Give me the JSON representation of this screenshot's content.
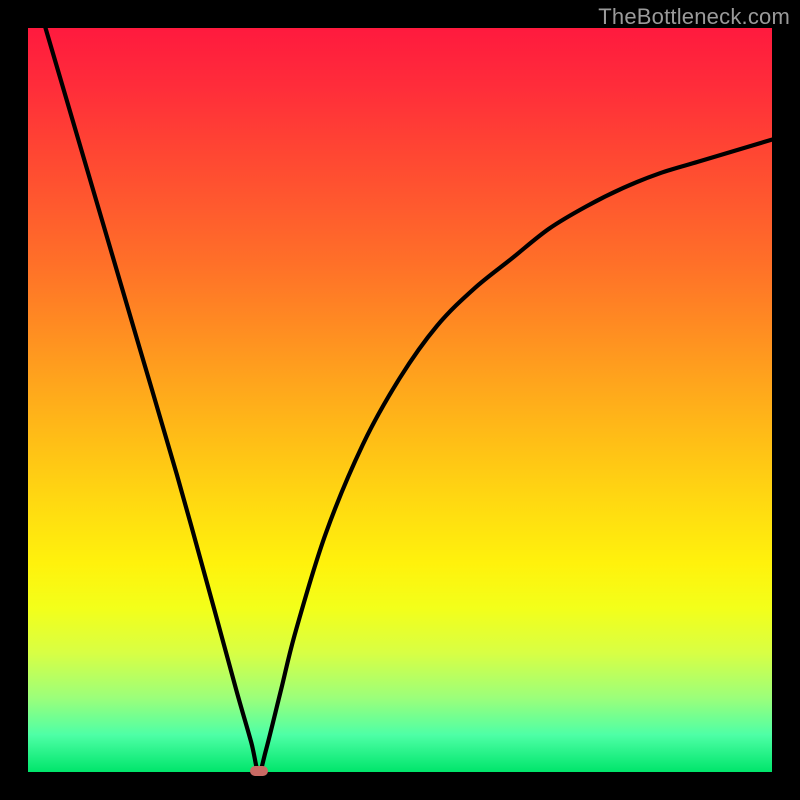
{
  "watermark": "TheBottleneck.com",
  "colors": {
    "background": "#000000",
    "gradient_top": "#ff1a3e",
    "gradient_bottom": "#00e56b",
    "curve": "#000000",
    "min_marker": "#c96a64"
  },
  "chart_data": {
    "type": "line",
    "title": "",
    "xlabel": "",
    "ylabel": "",
    "xlim": [
      0,
      100
    ],
    "ylim": [
      0,
      100
    ],
    "grid": false,
    "legend": false,
    "annotations": [
      "TheBottleneck.com"
    ],
    "interpretation": "V-shaped bottleneck curve over red-to-green vertical gradient; minimum near x≈31 at y≈0; background color encodes severity (red high, green low).",
    "series": [
      {
        "name": "bottleneck-curve",
        "x": [
          0,
          5,
          10,
          15,
          20,
          25,
          28,
          30,
          31,
          32,
          34,
          36,
          40,
          45,
          50,
          55,
          60,
          65,
          70,
          75,
          80,
          85,
          90,
          95,
          100
        ],
        "values": [
          108,
          91,
          74,
          57,
          40,
          22,
          11,
          4,
          0,
          3,
          11,
          19,
          32,
          44,
          53,
          60,
          65,
          69,
          73,
          76,
          78.5,
          80.5,
          82,
          83.5,
          85
        ]
      }
    ],
    "min_point": {
      "x": 31,
      "y": 0
    }
  }
}
